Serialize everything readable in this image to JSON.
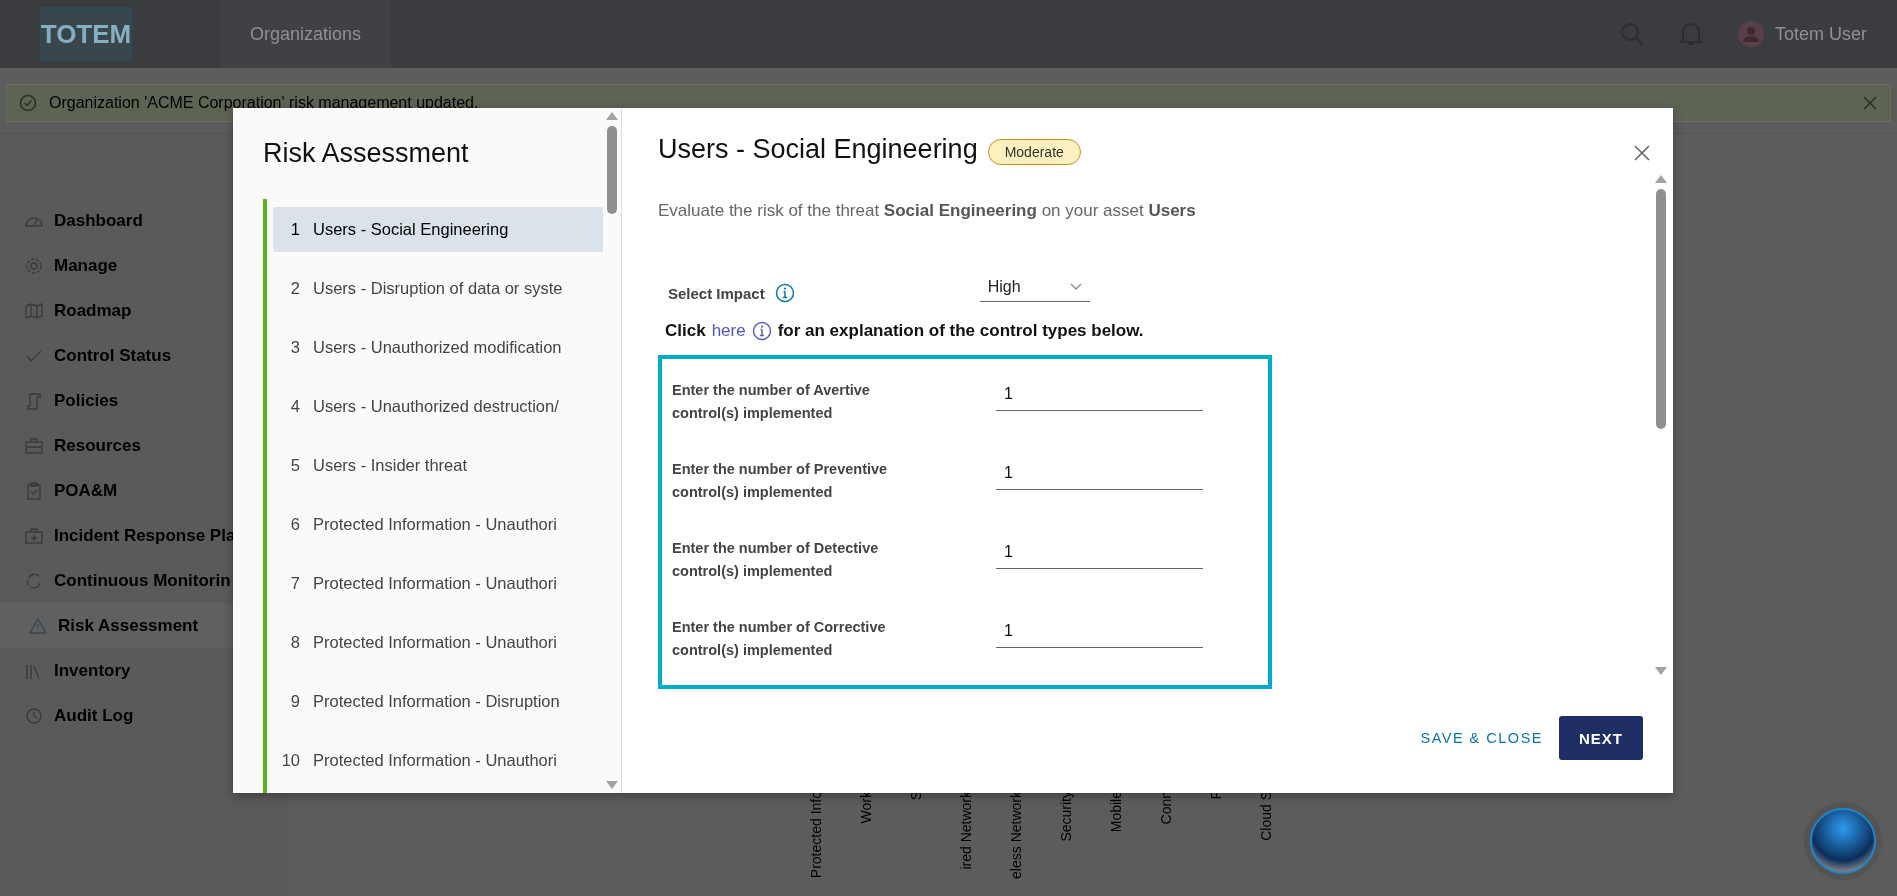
{
  "app": {
    "logo": "TOTEM",
    "nav_tab": "Organizations",
    "user_name": "Totem User"
  },
  "notification": {
    "message": "Organization 'ACME Corporation' risk management updated."
  },
  "sidebar": {
    "items": [
      {
        "label": "Dashboard",
        "selected": false
      },
      {
        "label": "Manage",
        "selected": false
      },
      {
        "label": "Roadmap",
        "selected": false
      },
      {
        "label": "Control Status",
        "selected": false
      },
      {
        "label": "Policies",
        "selected": false
      },
      {
        "label": "Resources",
        "selected": false
      },
      {
        "label": "POA&M",
        "selected": false
      },
      {
        "label": "Incident Response Pla",
        "selected": false
      },
      {
        "label": "Continuous Monitorin",
        "selected": false
      },
      {
        "label": "Risk Assessment",
        "selected": true
      },
      {
        "label": "Inventory",
        "selected": false
      },
      {
        "label": "Audit Log",
        "selected": false
      }
    ]
  },
  "background_chart": {
    "axis_labels": [
      "Protected Info",
      "Work",
      "S",
      "ired Network",
      "eless Network",
      "Security",
      "Mobile",
      "Conn",
      "F",
      "Cloud S"
    ]
  },
  "modal": {
    "title": "Risk Assessment",
    "steps": [
      {
        "number": "1",
        "label": "Users - Social Engineering",
        "selected": true
      },
      {
        "number": "2",
        "label": "Users - Disruption of data or syste",
        "selected": false
      },
      {
        "number": "3",
        "label": "Users - Unauthorized modification",
        "selected": false
      },
      {
        "number": "4",
        "label": "Users - Unauthorized destruction/",
        "selected": false
      },
      {
        "number": "5",
        "label": "Users - Insider threat",
        "selected": false
      },
      {
        "number": "6",
        "label": "Protected Information - Unauthori",
        "selected": false
      },
      {
        "number": "7",
        "label": "Protected Information - Unauthori",
        "selected": false
      },
      {
        "number": "8",
        "label": "Protected Information - Unauthori",
        "selected": false
      },
      {
        "number": "9",
        "label": "Protected Information - Disruption",
        "selected": false
      },
      {
        "number": "10",
        "label": "Protected Information - Unauthori",
        "selected": false
      }
    ],
    "threat": {
      "title": "Users - Social Engineering",
      "risk_badge": "Moderate",
      "description": "Evaluate the risk of the threat **Social Engineering** on your asset **Users**"
    },
    "impact": {
      "label": "Select Impact",
      "value": "High"
    },
    "explanation": {
      "before": "Click",
      "link": "here",
      "after": "for an explanation of the control types below."
    },
    "controls": [
      {
        "label": "Enter the number of Avertive control(s) implemented",
        "value": "1"
      },
      {
        "label": "Enter the number of Preventive control(s) implemented",
        "value": "1"
      },
      {
        "label": "Enter the number of Detective control(s) implemented",
        "value": "1"
      },
      {
        "label": "Enter the number of Corrective control(s) implemented",
        "value": "1"
      }
    ],
    "buttons": {
      "secondary": "SAVE & CLOSE",
      "primary": "NEXT"
    }
  }
}
